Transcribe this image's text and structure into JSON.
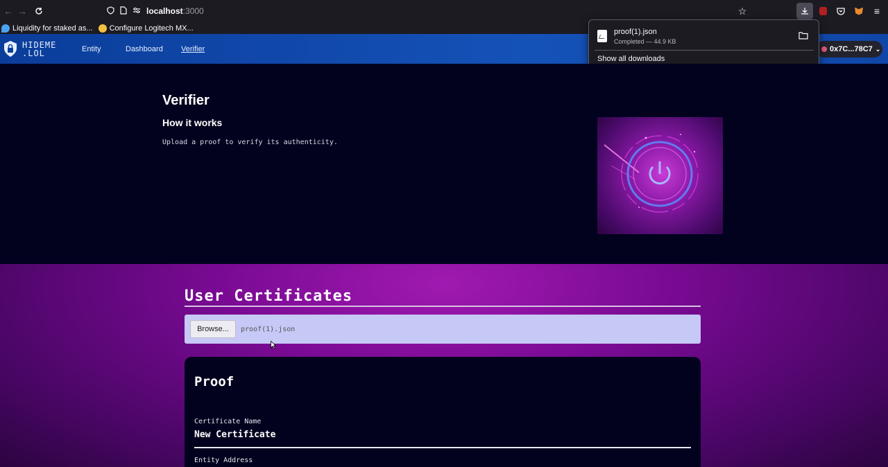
{
  "browser": {
    "url_host": "localhost",
    "url_port": ":3000",
    "bookmarks": [
      {
        "label": "Liquidity for staked as..."
      },
      {
        "label": "Configure Logitech MX..."
      }
    ],
    "colors": {
      "toolbar": "#1c1b22",
      "text": "#fbfbfe"
    }
  },
  "nav": {
    "logo_line1": "HIDEME",
    "logo_line2": ".LOL",
    "links": [
      {
        "label": "Entity"
      },
      {
        "label": "Dashboard"
      },
      {
        "label": "Verifier"
      }
    ],
    "active": "Verifier",
    "wallet_label": "0x7C...78C7"
  },
  "downloads": {
    "file_name": "proof(1).json",
    "status": "Completed — 44.9 KB",
    "show_all": "Show all downloads"
  },
  "verifier": {
    "title": "Verifier",
    "subtitle": "How it works",
    "description": "Upload a proof to verify its authenticity."
  },
  "certificates": {
    "title": "User Certificates",
    "browse_label": "Browse...",
    "selected_file": "proof(1).json"
  },
  "proof": {
    "title": "Proof",
    "certificate_name_label": "Certificate Name",
    "certificate_name_value": "New Certificate",
    "entity_address_label": "Entity Address"
  }
}
